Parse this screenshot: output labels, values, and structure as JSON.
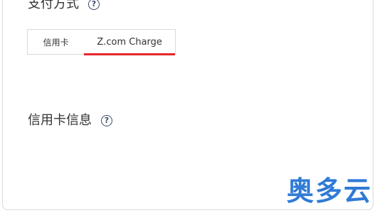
{
  "payment_section": {
    "title": "支付方式",
    "help_icon": "question-circle-icon",
    "tabs": [
      {
        "label": "信用卡",
        "active": false
      },
      {
        "label": "Z.com Charge",
        "active": true
      }
    ]
  },
  "card_info_section": {
    "title": "信用卡信息",
    "help_icon": "question-circle-icon"
  },
  "watermark": {
    "text": "奥多云"
  },
  "colors": {
    "active_underline": "#e4262c",
    "watermark": "#2f7bd6",
    "help_icon": "#3b4a66"
  }
}
